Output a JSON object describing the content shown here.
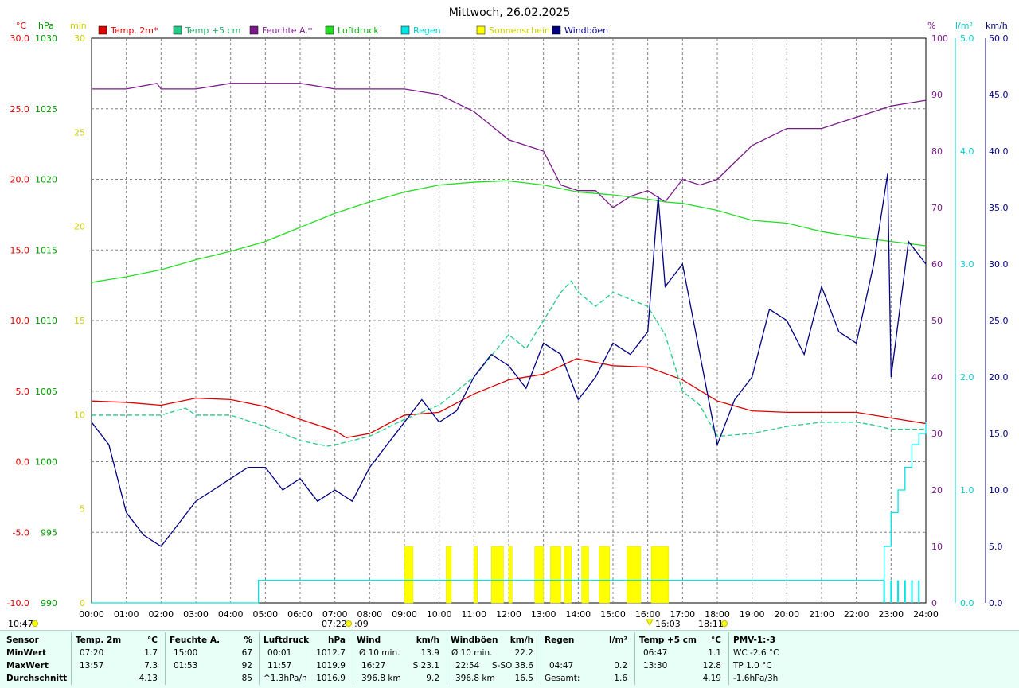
{
  "title": "Mittwoch, 26.02.2025",
  "axes": {
    "left1_unit": "°C",
    "left2_unit": "hPa",
    "left3_unit": "min",
    "right1_unit": "%",
    "right2_unit": "l/m²",
    "right3_unit": "km/h",
    "temp_ticks": [
      "30.0",
      "25.0",
      "20.0",
      "15.0",
      "10.0",
      "5.0",
      "0.0",
      "-5.0",
      "-10.0"
    ],
    "hpa_ticks": [
      "1030",
      "1025",
      "1020",
      "1015",
      "1010",
      "1005",
      "1000",
      "995",
      "990"
    ],
    "min_ticks": [
      "30",
      "25",
      "20",
      "15",
      "10",
      "5",
      "0"
    ],
    "pct_ticks": [
      "100",
      "90",
      "80",
      "70",
      "60",
      "50",
      "40",
      "30",
      "20",
      "10",
      "0"
    ],
    "rain_ticks": [
      "5.0",
      "4.0",
      "3.0",
      "2.0",
      "1.0",
      "0.0"
    ],
    "kmh_ticks": [
      "50.0",
      "45.0",
      "40.0",
      "35.0",
      "30.0",
      "25.0",
      "20.0",
      "15.0",
      "10.0",
      "5.0",
      "0.0"
    ],
    "x_ticks": [
      "00:00",
      "01:00",
      "02:00",
      "03:00",
      "04:00",
      "05:00",
      "06:00",
      "07:00",
      "08:00",
      "09:00",
      "10:00",
      "11:00",
      "12:00",
      "13:00",
      "14:00",
      "15:00",
      "16:00",
      "17:00",
      "18:00",
      "19:00",
      "20:00",
      "21:00",
      "22:00",
      "23:00",
      "24:00"
    ]
  },
  "legend": [
    {
      "label": "Temp. 2m*",
      "color": "#dd0000",
      "text_color": "#dd0000"
    },
    {
      "label": "Temp +5 cm",
      "color": "#22cc88",
      "text_color": "#22aa66"
    },
    {
      "label": "Feuchte A.*",
      "color": "#7a1a8a",
      "text_color": "#7a1a8a"
    },
    {
      "label": "Luftdruck",
      "color": "#22dd22",
      "text_color": "#11aa11"
    },
    {
      "label": "Regen",
      "color": "#00e5e5",
      "text_color": "#00cccc"
    },
    {
      "label": "Sonnenschein",
      "color": "#ffff00",
      "text_color": "#cccc00"
    },
    {
      "label": "Windböen",
      "color": "#000080",
      "text_color": "#000080"
    }
  ],
  "annotations": {
    "sunrise": "07:22",
    "sunrise_extra": ":09",
    "sunset": "18:11",
    "marker_1603": "16:03",
    "clock": "10:47"
  },
  "chart_data": {
    "type": "line",
    "title": "Mittwoch, 26.02.2025",
    "x_range": [
      "00:00",
      "24:00"
    ],
    "series": [
      {
        "name": "Temp. 2m*",
        "unit": "°C",
        "color": "#dd0000",
        "x": [
          0,
          1,
          2,
          3,
          4,
          5,
          6,
          7,
          7.33,
          8,
          9,
          10,
          11,
          12,
          13,
          13.95,
          15,
          16,
          17,
          18,
          19,
          20,
          21,
          22,
          23,
          24
        ],
        "y": [
          4.3,
          4.2,
          4.0,
          4.5,
          4.4,
          3.9,
          3.0,
          2.2,
          1.7,
          2.0,
          3.3,
          3.5,
          4.8,
          5.8,
          6.2,
          7.3,
          6.8,
          6.7,
          5.8,
          4.3,
          3.6,
          3.5,
          3.5,
          3.5,
          3.1,
          2.7
        ]
      },
      {
        "name": "Temp +5 cm",
        "unit": "°C",
        "color": "#22cc88",
        "x": [
          0,
          1,
          2,
          2.7,
          3,
          4,
          5,
          6,
          6.78,
          7,
          8,
          9,
          10,
          11,
          12,
          12.5,
          13,
          13.5,
          13.8,
          14,
          14.5,
          15,
          15.5,
          16,
          16.5,
          17,
          17.5,
          18,
          19,
          20,
          21,
          22,
          22.5,
          23,
          24
        ],
        "y": [
          3.3,
          3.3,
          3.3,
          3.8,
          3.3,
          3.3,
          2.5,
          1.5,
          1.1,
          1.2,
          1.8,
          3.0,
          4.0,
          6.0,
          9.0,
          8.0,
          10.0,
          12.0,
          12.8,
          12.0,
          11.0,
          12.0,
          11.5,
          11.0,
          9.0,
          5.0,
          4.0,
          1.8,
          2.0,
          2.5,
          2.8,
          2.8,
          2.6,
          2.3,
          2.3
        ]
      },
      {
        "name": "Feuchte A.*",
        "unit": "%",
        "color": "#7a1a8a",
        "x": [
          0,
          1,
          1.88,
          2,
          3,
          4,
          5,
          6,
          7,
          8,
          9,
          10,
          11,
          12,
          13,
          13.5,
          14,
          14.5,
          15,
          15.5,
          16,
          16.5,
          17,
          17.5,
          18,
          19,
          20,
          21,
          22,
          23,
          24
        ],
        "y": [
          91,
          91,
          92,
          91,
          91,
          92,
          92,
          92,
          91,
          91,
          91,
          90,
          87,
          82,
          80,
          74,
          73,
          73,
          70,
          72,
          73,
          71,
          75,
          74,
          75,
          81,
          84,
          84,
          86,
          88,
          89
        ]
      },
      {
        "name": "Luftdruck",
        "unit": "hPa",
        "color": "#22dd22",
        "x": [
          0,
          1,
          2,
          3,
          4,
          5,
          6,
          7,
          8,
          9,
          10,
          11,
          11.95,
          13,
          14,
          15,
          16,
          16.5,
          17,
          18,
          19,
          20,
          21,
          22,
          23,
          24
        ],
        "y": [
          1012.7,
          1013.1,
          1013.6,
          1014.3,
          1014.9,
          1015.6,
          1016.6,
          1017.6,
          1018.4,
          1019.1,
          1019.6,
          1019.8,
          1019.9,
          1019.6,
          1019.1,
          1018.9,
          1018.6,
          1018.4,
          1018.3,
          1017.8,
          1017.1,
          1016.9,
          1016.3,
          1015.9,
          1015.6,
          1015.3
        ]
      },
      {
        "name": "Regen",
        "unit": "l/m²",
        "color": "#00e5e5",
        "x": [
          0,
          4.78,
          4.8,
          22.7,
          22.8,
          23,
          23.2,
          23.4,
          23.6,
          23.8,
          24
        ],
        "y": [
          0,
          0,
          0.2,
          0.2,
          0.5,
          0.8,
          1.0,
          1.2,
          1.4,
          1.5,
          1.6
        ]
      },
      {
        "name": "Windböen",
        "unit": "km/h",
        "color": "#000080",
        "x": [
          0,
          0.5,
          1,
          1.5,
          2,
          2.5,
          3,
          3.5,
          4,
          4.5,
          5,
          5.5,
          6,
          6.5,
          7,
          7.5,
          8,
          8.5,
          9,
          9.5,
          10,
          10.5,
          11,
          11.5,
          12,
          12.5,
          13,
          13.5,
          14,
          14.5,
          15,
          15.5,
          16,
          16.3,
          16.5,
          17,
          17.5,
          18,
          18.5,
          19,
          19.5,
          20,
          20.5,
          21,
          21.5,
          22,
          22.5,
          22.9,
          23,
          23.5,
          24
        ],
        "y": [
          16,
          14,
          8,
          6,
          5,
          7,
          9,
          10,
          11,
          12,
          12,
          10,
          11,
          9,
          10,
          9,
          12,
          14,
          16,
          18,
          16,
          17,
          20,
          22,
          21,
          19,
          23,
          22,
          18,
          20,
          23,
          22,
          24,
          36,
          28,
          30,
          22,
          14,
          18,
          20,
          26,
          25,
          22,
          28,
          24,
          23,
          30,
          38,
          20,
          32,
          30
        ]
      }
    ],
    "sunshine_hours": [
      [
        9.0,
        9.25
      ],
      [
        10.2,
        10.35
      ],
      [
        11.0,
        11.1
      ],
      [
        11.5,
        11.85
      ],
      [
        12.0,
        12.1
      ],
      [
        12.75,
        13.0
      ],
      [
        13.2,
        13.5
      ],
      [
        13.6,
        13.8
      ],
      [
        14.1,
        14.3
      ],
      [
        14.6,
        14.9
      ],
      [
        15.4,
        15.8
      ],
      [
        16.1,
        16.6
      ]
    ],
    "rain_bars_hours": [
      22.8,
      23.0,
      23.2,
      23.4,
      23.6,
      23.8
    ]
  },
  "summary": {
    "headers": [
      "Sensor",
      "Temp. 2m",
      "°C",
      "Feuchte A.",
      "%",
      "Luftdruck",
      "hPa",
      "Wind",
      "km/h",
      "Windböen",
      "km/h",
      "Regen",
      "l/m²",
      "Temp +5 cm",
      "°C",
      "PMV-1:-3"
    ],
    "row_labels": [
      "MinWert",
      "MaxWert",
      "Durchschnitt"
    ],
    "temp2m": {
      "min_time": "07:20",
      "min": "1.7",
      "max_time": "13:57",
      "max": "7.3",
      "avg": "4.13"
    },
    "feuchte": {
      "min_time": "15:00",
      "min": "67",
      "max_time": "01:53",
      "max": "92",
      "avg": "85"
    },
    "luftdruck": {
      "min_time": "00:01",
      "min": "1012.7",
      "max_time": "11:57",
      "max": "1019.9",
      "trend": "^1.3hPa/h",
      "avg": "1016.9"
    },
    "wind": {
      "label1": "Ø 10 min.",
      "val1": "13.9",
      "time2": "16:27",
      "dir2": "S 23.1",
      "dist": "396.8 km",
      "avg": "9.2"
    },
    "windboeen": {
      "label1": "Ø 10 min.",
      "val1": "22.2",
      "time2": "22:54",
      "dir2": "S-SO 38.6",
      "dist": "396.8 km",
      "avg": "16.5"
    },
    "regen": {
      "time2": "04:47",
      "val2": "0.2",
      "label3": "Gesamt:",
      "val3": "1.6"
    },
    "temp5cm": {
      "min_time": "06:47",
      "min": "1.1",
      "max_time": "13:30",
      "max": "12.8",
      "avg": "4.19"
    },
    "pmv": {
      "r1": "WC -2.6 °C",
      "r2": "TP 1.0 °C",
      "r3": "-1.6hPa/3h"
    }
  }
}
